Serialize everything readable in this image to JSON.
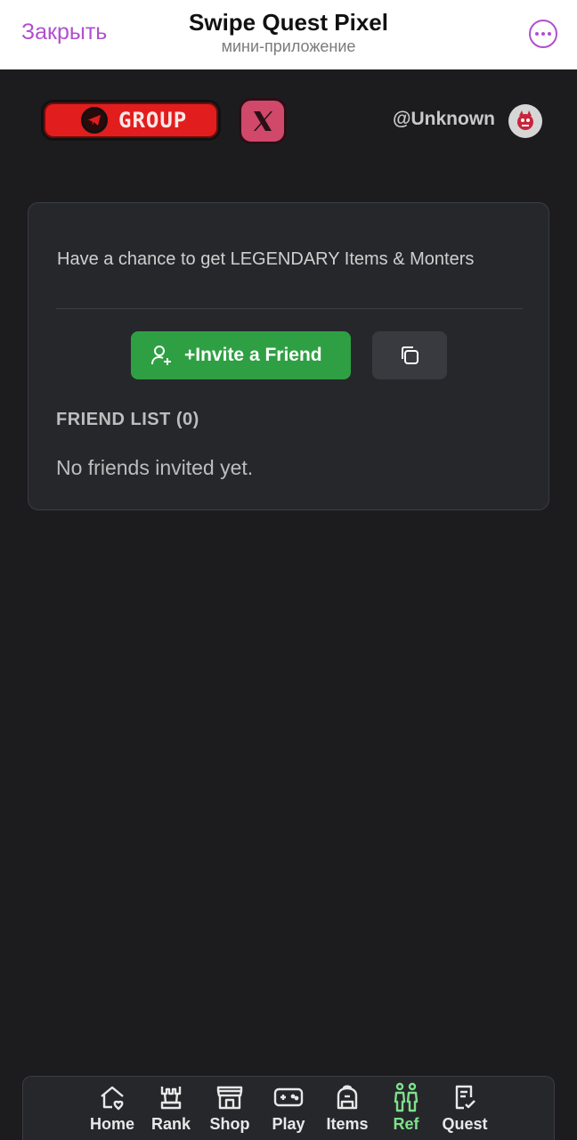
{
  "topbar": {
    "close_label": "Закрыть",
    "title": "Swipe Quest Pixel",
    "subtitle": "мини-приложение",
    "more_icon": "ellipsis-circle-icon"
  },
  "header": {
    "group_label": "GROUP",
    "username": "@Unknown"
  },
  "card": {
    "promo_text": "Have a chance to get LEGENDARY Items & Monters",
    "invite_label": "+Invite a Friend",
    "friend_list_title": "FRIEND LIST (0)",
    "empty_text": "No friends invited yet."
  },
  "nav": {
    "items": [
      {
        "label": "Home",
        "icon": "home-icon"
      },
      {
        "label": "Rank",
        "icon": "crown-icon"
      },
      {
        "label": "Shop",
        "icon": "store-icon"
      },
      {
        "label": "Play",
        "icon": "gamepad-icon"
      },
      {
        "label": "Items",
        "icon": "backpack-icon"
      },
      {
        "label": "Ref",
        "icon": "people-icon"
      },
      {
        "label": "Quest",
        "icon": "checklist-icon"
      }
    ],
    "active": "Ref"
  },
  "colors": {
    "accent": "#b14fd0",
    "invite_green": "#2ea043",
    "active_nav": "#7ee08a",
    "background": "#1c1c1f",
    "card": "#26272b"
  }
}
